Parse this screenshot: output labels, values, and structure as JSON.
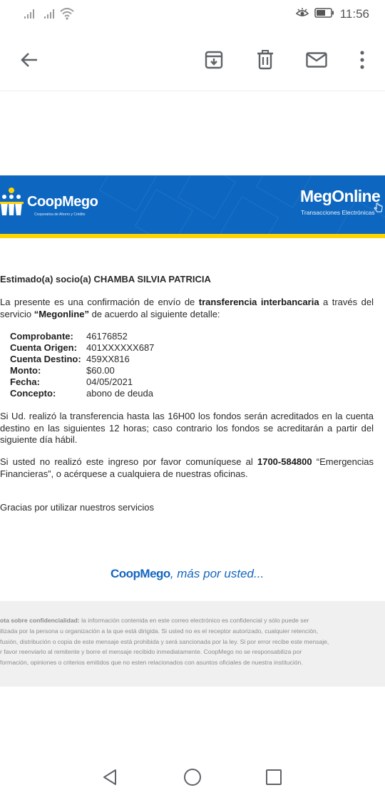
{
  "status_bar": {
    "time": "11:56",
    "icons": [
      "signal-icon",
      "signal-icon",
      "wifi-icon",
      "eye-comfort-icon",
      "battery-icon"
    ]
  },
  "app_bar": {
    "icons": [
      "back-arrow-icon",
      "archive-icon",
      "delete-icon",
      "mark-unread-icon",
      "more-options-icon"
    ]
  },
  "banner": {
    "brand_name": "CoopMego",
    "brand_tagline": "Cooperativa de Ahorro y Crédito",
    "service_name": "MegOnline",
    "service_tagline": "Transacciones Electrónicas",
    "background_color": "#0d67c0",
    "stripe_color": "#ffd200"
  },
  "email": {
    "greeting": "Estimado(a) socio(a) CHAMBA SILVIA PATRICIA",
    "intro_part1": "La presente es una confirmación de envío de ",
    "intro_bold1": "transferencia interbancaria",
    "intro_part2": " a través del servicio ",
    "intro_bold2": "“Megonline”",
    "intro_part3": " de acuerdo al siguiente detalle:",
    "details": [
      {
        "label": "Comprobante:",
        "value": "46176852"
      },
      {
        "label": "Cuenta Origen:",
        "value": "401XXXXXX687"
      },
      {
        "label": "Cuenta Destino:",
        "value": "459XX816"
      },
      {
        "label": "Monto:",
        "value": "$60.00"
      },
      {
        "label": "Fecha:",
        "value": "04/05/2021"
      },
      {
        "label": "Concepto:",
        "value": "abono de deuda"
      }
    ],
    "timing_note": "Si Ud. realizó la transferencia hasta las 16H00 los fondos serán acreditados en la cuenta destino en las siguientes 12 horas; caso contrario los fondos se acreditarán a partir del siguiente día hábil.",
    "contact_part1": "Si usted no realizó este ingreso por favor comuníquese al ",
    "contact_phone": "1700-584800",
    "contact_part2": " “Emergencias Financieras”, o acérquese a cualquiera de nuestras oficinas.",
    "thanks": "Gracias por utilizar nuestros servicios",
    "footer_brand": "CoopMego",
    "footer_tagline": ", más por usted...",
    "disclaimer_lead": "ota sobre confidencialidad:",
    "disclaimer_lines": [
      " la información contenida en este correo electrónico es confidencial y sólo puede ser",
      "ilizada por la persona u organización a la que está dirigida. Si usted no es el receptor autorizado, cualquier retención,",
      "fusión, distribución o copia de este mensaje está prohibida y será sancionada por la ley. Si por error recibe este mensaje,",
      "r favor reenviarlo al remitente y borre el mensaje recibido inmediatamente. CoopMego no se responsabiliza por",
      "formación, opiniones o criterios emitidos que no esten relacionados con asuntos oficiales de nuestra institución."
    ]
  },
  "nav_bar": {
    "icons": [
      "back-triangle-icon",
      "home-circle-icon",
      "recents-square-icon"
    ]
  }
}
